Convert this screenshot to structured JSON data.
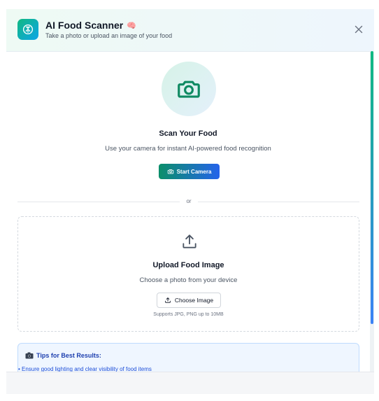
{
  "header": {
    "title": "AI Food Scanner",
    "title_emoji": "🧠",
    "subtitle": "Take a photo or upload an image of your food",
    "logo_icon": "brain-icon",
    "close_icon": "close-icon"
  },
  "camera": {
    "icon": "camera-icon",
    "title": "Scan Your Food",
    "description": "Use your camera for instant AI-powered food recognition",
    "button_label": "Start Camera"
  },
  "divider_label": "or",
  "upload": {
    "icon": "upload-icon",
    "title": "Upload Food Image",
    "description": "Choose a photo from your device",
    "button_label": "Choose Image",
    "supports": "Supports JPG, PNG up to 10MB"
  },
  "tips": {
    "icon": "camera-emoji-icon",
    "title": "Tips for Best Results:",
    "items": [
      "• Ensure good lighting and clear visibility of food items"
    ]
  },
  "colors": {
    "accent_green": "#10b981",
    "accent_blue": "#2563eb",
    "tips_text": "#1d4ed8"
  }
}
